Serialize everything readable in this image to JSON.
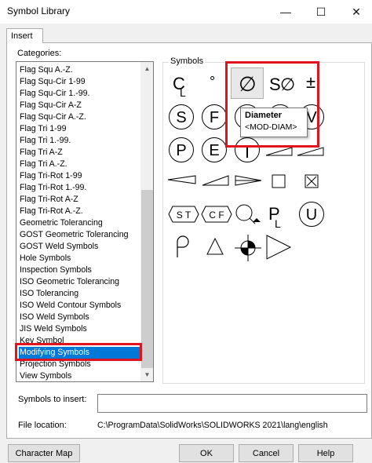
{
  "window": {
    "title": "Symbol Library",
    "minimize_glyph": "—",
    "maximize_glyph": "☐",
    "close_glyph": "✕"
  },
  "tab": {
    "label": "Insert"
  },
  "categories": {
    "label": "Categories:",
    "items": [
      "Flag Squ A.-Z.",
      "Flag Squ-Cir 1-99",
      "Flag Squ-Cir 1.-99.",
      "Flag Squ-Cir A-Z",
      "Flag Squ-Cir A.-Z.",
      "Flag Tri 1-99",
      "Flag Tri 1.-99.",
      "Flag Tri A-Z",
      "Flag Tri A.-Z.",
      "Flag Tri-Rot 1-99",
      "Flag Tri-Rot 1.-99.",
      "Flag Tri-Rot A-Z",
      "Flag Tri-Rot A.-Z.",
      "Geometric Tolerancing",
      "GOST Geometric Tolerancing",
      "GOST Weld Symbols",
      "Hole Symbols",
      "Inspection Symbols",
      "ISO Geometric Tolerancing",
      "ISO Tolerancing",
      "ISO Weld Contour Symbols",
      "ISO Weld Symbols",
      "JIS Weld Symbols",
      "Key Symbol",
      "Modifying Symbols",
      "Projection Symbols",
      "View Symbols"
    ],
    "selected": "Modifying Symbols"
  },
  "symbols": {
    "group_label": "Symbols",
    "glyphs": {
      "cl_c": "C",
      "cl_l": "L",
      "degree": "°",
      "diameter": "∅",
      "sdiam_s": "S",
      "sdiam_o": "∅",
      "plusminus": "±",
      "s": "S",
      "f": "F",
      "v": "V",
      "p": "P",
      "e": "E",
      "st": "S T",
      "cf": "C F",
      "pl_p": "P",
      "pl_l": "L",
      "u": "U"
    }
  },
  "tooltip": {
    "title": "Diameter",
    "code": "<MOD-DIAM>"
  },
  "symbols_to_insert": {
    "label": "Symbols to insert:",
    "value": ""
  },
  "file_location": {
    "label": "File location:",
    "path": "C:\\ProgramData\\SolidWorks\\SOLIDWORKS 2021\\lang\\english"
  },
  "buttons": {
    "character_map": "Character Map",
    "ok": "OK",
    "cancel": "Cancel",
    "help": "Help"
  },
  "colors": {
    "selection": "#0078d7",
    "highlight_box": "#e0141e"
  }
}
